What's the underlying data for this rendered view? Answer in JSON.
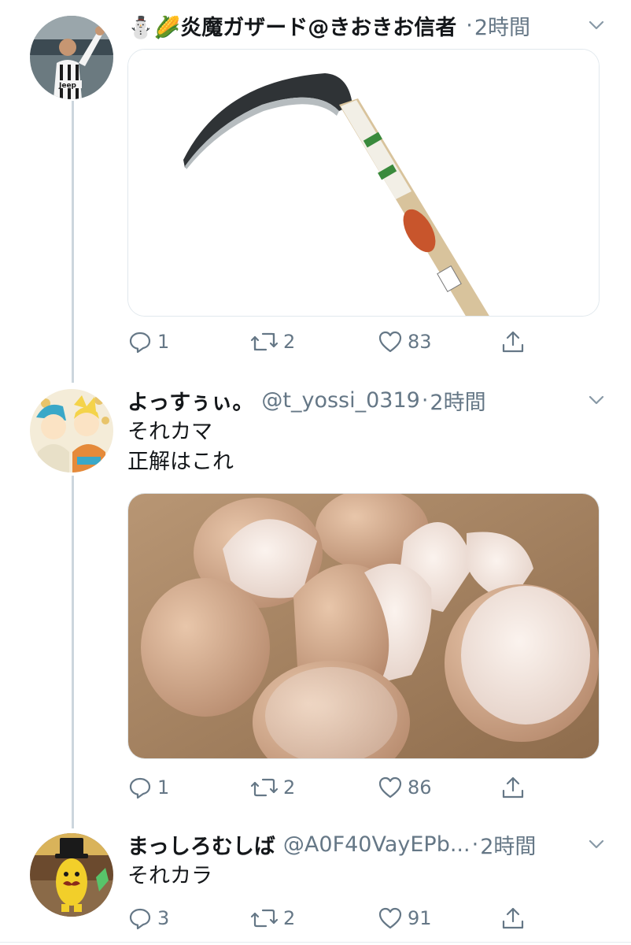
{
  "tweets": [
    {
      "name": "⛄🌽炎魔ガザード@きおきお信者",
      "handle": "",
      "dot": "·",
      "time": "2時間",
      "text": [],
      "media": "sickle-image",
      "replies": "1",
      "retweets": "2",
      "likes": "83"
    },
    {
      "name": "よっすぅぃ。",
      "handle": "@t_yossi_0319",
      "dot": "·",
      "time": "2時間",
      "text": [
        "それカマ",
        "正解はこれ"
      ],
      "media": "eggshells-image",
      "replies": "1",
      "retweets": "2",
      "likes": "86"
    },
    {
      "name": "まっしろむしば",
      "handle": "@A0F40VayEPb...",
      "dot": "·",
      "time": "2時間",
      "text": [
        "それカラ"
      ],
      "media": "",
      "replies": "3",
      "retweets": "2",
      "likes": "91"
    }
  ],
  "colors": {
    "text": "#14171a",
    "secondary": "#657786",
    "thread_line": "#ccd6dd"
  },
  "icons": [
    "reply-icon",
    "retweet-icon",
    "like-icon",
    "share-icon",
    "chevron-down-icon"
  ]
}
